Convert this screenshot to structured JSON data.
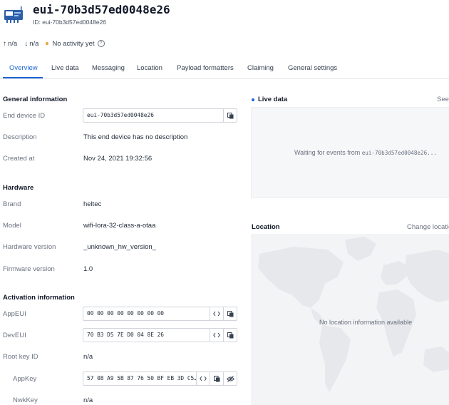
{
  "device": {
    "title": "eui-70b3d57ed0048e26",
    "id_line": "ID: eui-70b3d57ed0048e26"
  },
  "stats": {
    "uplink": "n/a",
    "downlink": "n/a",
    "activity": "No activity yet"
  },
  "tabs": [
    {
      "label": "Overview",
      "active": true
    },
    {
      "label": "Live data"
    },
    {
      "label": "Messaging"
    },
    {
      "label": "Location"
    },
    {
      "label": "Payload formatters"
    },
    {
      "label": "Claiming"
    },
    {
      "label": "General settings"
    }
  ],
  "general": {
    "title": "General information",
    "end_device_id_label": "End device ID",
    "end_device_id": "eui-70b3d57ed0048e26",
    "description_label": "Description",
    "description": "This end device has no description",
    "created_label": "Created at",
    "created": "Nov 24, 2021 19:32:56"
  },
  "hardware": {
    "title": "Hardware",
    "brand_label": "Brand",
    "brand": "heltec",
    "model_label": "Model",
    "model": "wifi-lora-32-class-a-otaa",
    "hw_version_label": "Hardware version",
    "hw_version": "_unknown_hw_version_",
    "fw_version_label": "Firmware version",
    "fw_version": "1.0"
  },
  "activation": {
    "title": "Activation information",
    "appeui_label": "AppEUI",
    "appeui": "00 00 00 00 00 00 00 00",
    "deveui_label": "DevEUI",
    "deveui": "70 B3 D5 7E D0 04 8E 26",
    "root_key_label": "Root key ID",
    "root_key": "n/a",
    "appkey_label": "AppKey",
    "appkey": "57 08 A9 5B 87 76 50 BF EB 3D C5…",
    "nwkkey_label": "NwkKey",
    "nwkkey": "n/a"
  },
  "live": {
    "title": "Live data",
    "see_all": "See",
    "waiting_prefix": "Waiting for events from ",
    "waiting_device": "eui-70b3d57ed0048e26..."
  },
  "location": {
    "title": "Location",
    "change": "Change locatio",
    "empty": "No location information available"
  },
  "colors": {
    "accent": "#1b65d4",
    "activity_dot": "#e6a23c",
    "device_icon": "#2c5fa8"
  },
  "icons": {
    "device": "device-board-icon",
    "copy": "copy-icon",
    "code": "code-brackets-icon",
    "hide": "eye-slash-icon",
    "help": "help-circle-icon"
  }
}
